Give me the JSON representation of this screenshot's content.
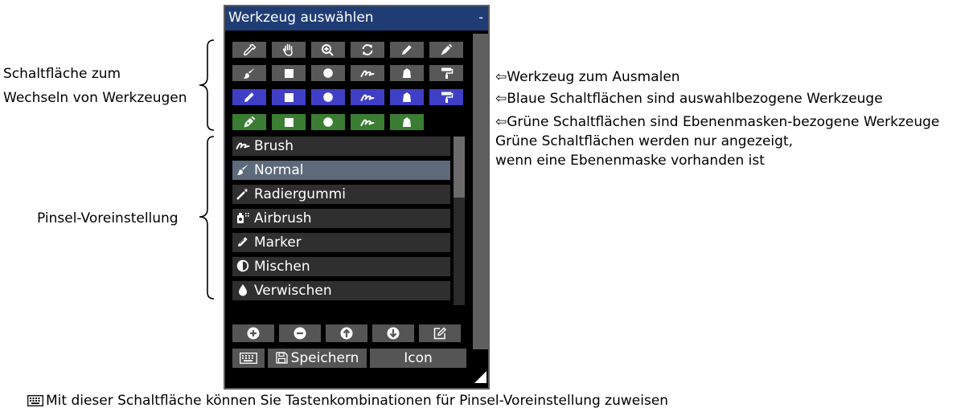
{
  "panel": {
    "title": "Werkzeug auswählen",
    "minimize": "-",
    "presets": [
      {
        "label": "Brush",
        "icon": "brush-stroke-icon",
        "selected": false
      },
      {
        "label": "Normal",
        "icon": "paintbrush-icon",
        "selected": true
      },
      {
        "label": "Radiergummi",
        "icon": "magic-wand-icon",
        "selected": false
      },
      {
        "label": "Airbrush",
        "icon": "airbrush-icon",
        "selected": false
      },
      {
        "label": "Marker",
        "icon": "marker-pen-icon",
        "selected": false
      },
      {
        "label": "Mischen",
        "icon": "half-circle-icon",
        "selected": false
      },
      {
        "label": "Verwischen",
        "icon": "droplet-icon",
        "selected": false
      }
    ],
    "save_label": "Speichern",
    "icon_label": "Icon"
  },
  "colors": {
    "titlebar": "#1f3d74",
    "blue_tools": "#3f3fc6",
    "green_tools": "#3a7d33",
    "gray_tools": "#585858"
  },
  "annotations": {
    "left_top_line1": "Schaltfläche zum",
    "left_top_line2": "Wechseln von Werkzeugen",
    "left_bottom": "Pinsel-Voreinstellung",
    "right_1": "Werkzeug zum Ausmalen",
    "right_2": "Blaue Schaltflächen sind auswahlbezogene Werkzeuge",
    "right_3": "Grüne Schaltflächen sind Ebenenmasken-bezogene Werkzeuge",
    "right_4": "Grüne Schaltflächen werden nur angezeigt,",
    "right_5": "wenn eine Ebenenmaske vorhanden ist",
    "bottom": "Mit dieser Schaltfläche können Sie Tastenkombinationen für Pinsel-Voreinstellung zuweisen"
  }
}
